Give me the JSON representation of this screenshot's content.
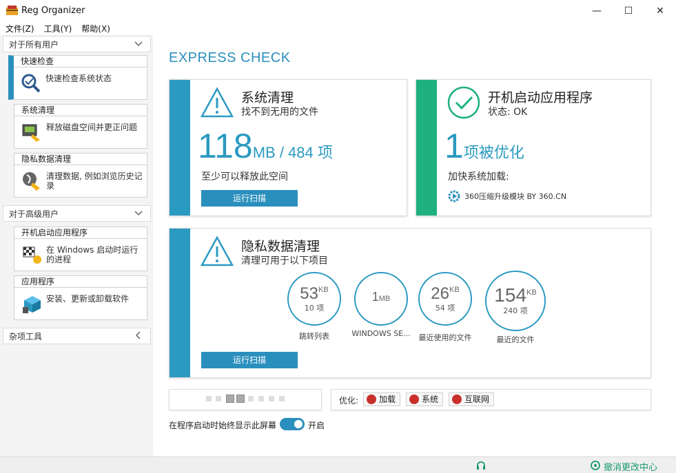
{
  "window": {
    "title": "Reg Organizer",
    "min": "—",
    "max": "☐",
    "close": "✕"
  },
  "menu": [
    "文件(Z)",
    "工具(Y)",
    "帮助(X)"
  ],
  "sidebar": {
    "section_all": "对于所有用户",
    "section_adv": "对于高级用户",
    "section_misc": "杂项工具",
    "tools": [
      {
        "title": "快速检查",
        "desc": "快速检查系统状态",
        "icon": "magnifier-check-icon"
      },
      {
        "title": "系统清理",
        "desc": "释放磁盘空间并更正问题",
        "icon": "disk-cleanup-icon"
      },
      {
        "title": "隐私数据清理",
        "desc": "清理数据, 例如浏览历史记录",
        "icon": "privacy-clean-icon"
      },
      {
        "title": "开机启动应用程序",
        "desc": "在 Windows 启动时运行的进程",
        "icon": "startup-flag-icon"
      },
      {
        "title": "应用程序",
        "desc": "安装、更新或卸载软件",
        "icon": "app-box-icon"
      }
    ]
  },
  "main": {
    "title": "EXPRESS CHECK",
    "system_clean": {
      "title": "系统清理",
      "sub": "找不到无用的文件",
      "big_num": "118",
      "big_unit": "MB / 484 项",
      "note": "至少可以释放此空间",
      "button": "运行扫描"
    },
    "startup": {
      "title": "开机启动应用程序",
      "sub": "状态: OK",
      "big_num": "1",
      "big_unit": "项被优化",
      "note": "加快系统加载:",
      "item": "360压缩升级模块 BY 360.CN"
    },
    "privacy": {
      "title": "隐私数据清理",
      "sub": "清理可用于以下项目",
      "button": "运行扫描",
      "circles": [
        {
          "num": "53",
          "unit": "KB",
          "sub": "10 项",
          "label": "跳转列表"
        },
        {
          "num": "1",
          "unit": "MB",
          "sub": "",
          "label": "WINDOWS SE..."
        },
        {
          "num": "26",
          "unit": "KB",
          "sub": "54 项",
          "label": "最近使用的文件"
        },
        {
          "num": "154",
          "unit": "KB",
          "sub": "240 项",
          "label": "最近的文件"
        }
      ]
    },
    "optimize": {
      "label": "优化:",
      "buttons": [
        "加载",
        "系统",
        "互联网"
      ]
    },
    "pager": {
      "count": 8,
      "selected": [
        2,
        3
      ]
    },
    "toggle": {
      "text": "在程序启动时始终显示此屏幕",
      "state": "开启"
    }
  },
  "statusbar": {
    "undo": "撤消更改中心"
  },
  "colors": {
    "accent": "#2b8fbd",
    "green": "#1fb07f",
    "power_red": "#c9302c"
  }
}
